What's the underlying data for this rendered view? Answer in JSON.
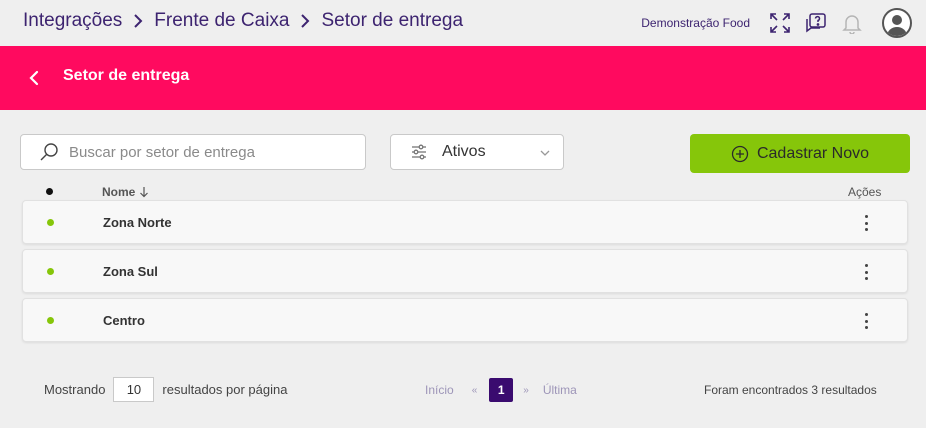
{
  "breadcrumb": {
    "items": [
      "Integrações",
      "Frente de Caixa",
      "Setor de entrega"
    ]
  },
  "topbar": {
    "company": "Demonstração Food",
    "icons": [
      "fullscreen-icon",
      "help-chat-icon",
      "bell-icon",
      "user-avatar-icon"
    ]
  },
  "header": {
    "title": "Setor de entrega",
    "color": "#ff0a5f"
  },
  "search": {
    "placeholder": "Buscar por setor de entrega",
    "value": ""
  },
  "filter": {
    "selected": "Ativos"
  },
  "new_button": {
    "label": "Cadastrar Novo",
    "color": "#86c60a"
  },
  "table": {
    "columns": {
      "name": "Nome",
      "actions": "Ações"
    },
    "rows": [
      {
        "name": "Zona Norte",
        "status": "active"
      },
      {
        "name": "Zona Sul",
        "status": "active"
      },
      {
        "name": "Centro",
        "status": "active"
      }
    ]
  },
  "footer": {
    "showing_label": "Mostrando",
    "per_page": "10",
    "per_page_suffix": "resultados por página",
    "pagination": {
      "first": "Início",
      "prev": "«",
      "current": "1",
      "next": "»",
      "last": "Última"
    },
    "results_text": "Foram encontrados 3 resultados"
  }
}
